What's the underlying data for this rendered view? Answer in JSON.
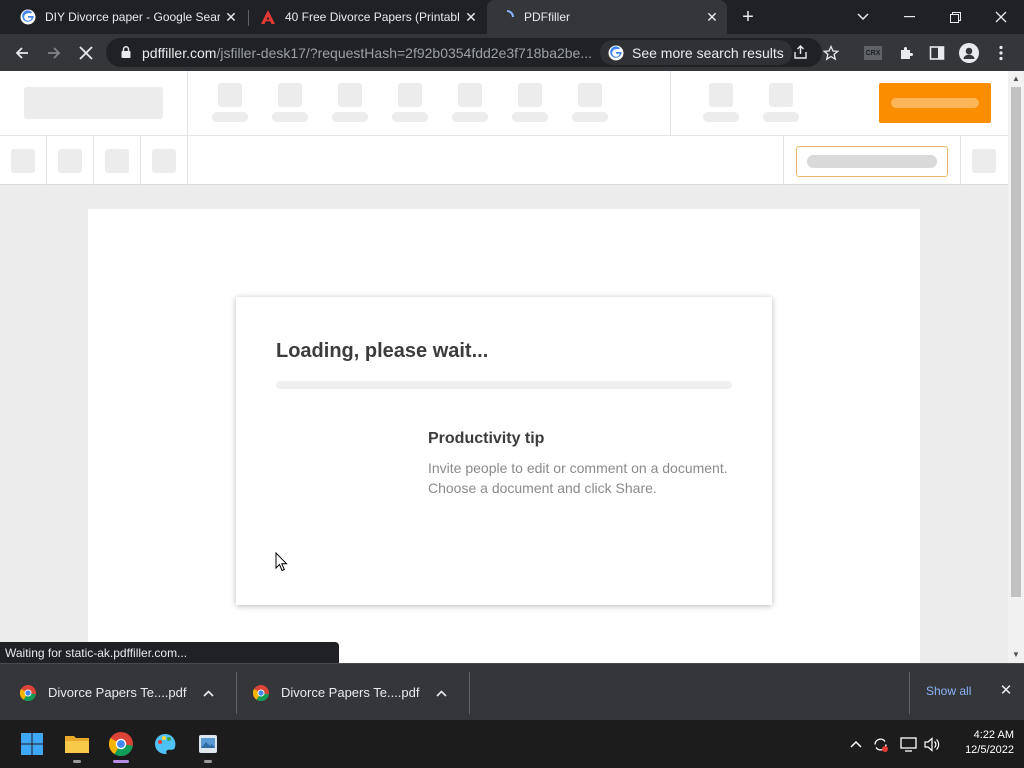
{
  "browser": {
    "tabs": [
      {
        "title": "DIY Divorce paper - Google Search",
        "favicon": "google-icon",
        "active": false
      },
      {
        "title": "40 Free Divorce Papers (Printable)",
        "favicon": "site-a-icon",
        "active": false
      },
      {
        "title": "PDFfiller",
        "favicon": "loading-spinner-icon",
        "active": true
      }
    ],
    "address": {
      "domain": "pdffiller.com",
      "path": "/jsfiller-desk17/?requestHash=2f92b0354fdd2e3f718ba2be...",
      "chip_label": "See more search results"
    },
    "extension_label": "CRX"
  },
  "page": {
    "loader": {
      "heading": "Loading, please wait...",
      "progress": 0,
      "tip_title": "Productivity tip",
      "tip_body": "Invite people to edit or comment on a document. Choose a document and click Share."
    },
    "status_text": "Waiting for static-ak.pdffiller.com..."
  },
  "downloads": {
    "items": [
      {
        "name": "Divorce Papers Te....pdf"
      },
      {
        "name": "Divorce Papers Te....pdf"
      }
    ],
    "show_all": "Show all"
  },
  "taskbar": {
    "time": "4:22 AM",
    "date": "12/5/2022"
  },
  "colors": {
    "accent_orange": "#fb8e00",
    "link_blue": "#8ab4f8",
    "chrome_dark": "#202124",
    "chrome_toolbar": "#35363a"
  }
}
